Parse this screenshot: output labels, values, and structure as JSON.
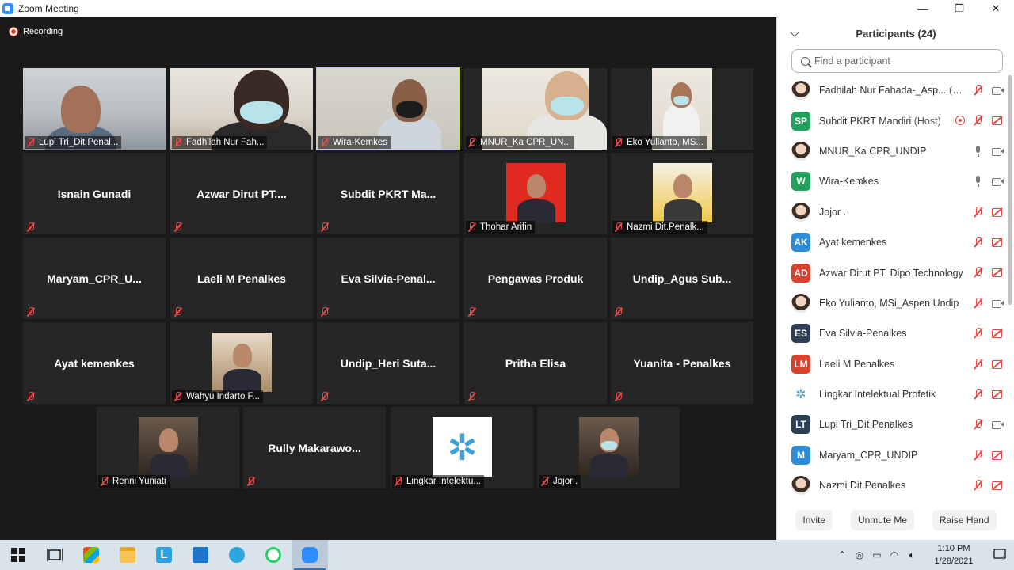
{
  "window": {
    "title": "Zoom Meeting",
    "minimize": "—",
    "restore": "❐",
    "close": "✕"
  },
  "meeting": {
    "recording_label": "Recording",
    "tiles": [
      {
        "name": "Lupi Tri_Dit Penal...",
        "kind": "video"
      },
      {
        "name": "Fadhilah Nur Fah...",
        "kind": "video"
      },
      {
        "name": "Wira-Kemkes",
        "kind": "video",
        "active": true
      },
      {
        "name": "MNUR_Ka CPR_UN...",
        "kind": "video"
      },
      {
        "name": "Eko Yulianto, MS...",
        "kind": "video"
      },
      {
        "name": "Isnain Gunadi",
        "kind": "name"
      },
      {
        "name": "Azwar Dirut PT....",
        "kind": "name"
      },
      {
        "name": "Subdit PKRT Ma...",
        "kind": "name"
      },
      {
        "name": "Thohar Arifin",
        "kind": "photo"
      },
      {
        "name": "Nazmi Dit.Penalk...",
        "kind": "photo"
      },
      {
        "name": "Maryam_CPR_U...",
        "kind": "name"
      },
      {
        "name": "Laeli M Penalkes",
        "kind": "name"
      },
      {
        "name": "Eva Silvia-Penal...",
        "kind": "name"
      },
      {
        "name": "Pengawas Produk",
        "kind": "name"
      },
      {
        "name": "Undip_Agus Sub...",
        "kind": "name"
      },
      {
        "name": "Ayat kemenkes",
        "kind": "name"
      },
      {
        "name": "Wahyu Indarto F...",
        "kind": "photo"
      },
      {
        "name": "Undip_Heri Suta...",
        "kind": "name"
      },
      {
        "name": "Pritha Elisa",
        "kind": "name"
      },
      {
        "name": "Yuanita - Penalkes",
        "kind": "name"
      },
      {
        "name": "Renni Yuniati",
        "kind": "photo"
      },
      {
        "name": "Rully Makarawo...",
        "kind": "name"
      },
      {
        "name": "Lingkar Intelektu...",
        "kind": "photo"
      },
      {
        "name": "Jojor .",
        "kind": "photo"
      }
    ]
  },
  "participants": {
    "title": "Participants (24)",
    "search_placeholder": "Find a participant",
    "list": [
      {
        "name": "Fadhilah Nur Fahada-_Asp...",
        "tag": "(Me)",
        "avatar": "",
        "avatar_color": "",
        "mic": "off",
        "cam": "on"
      },
      {
        "name": "Subdit PKRT Mandiri",
        "tag": "(Host)",
        "avatar": "SP",
        "avatar_color": "#1fa35c",
        "mic": "off",
        "cam": "off",
        "sharing": true
      },
      {
        "name": "MNUR_Ka CPR_UNDIP",
        "tag": "",
        "avatar": "",
        "avatar_color": "",
        "mic": "on",
        "cam": "on"
      },
      {
        "name": "Wira-Kemkes",
        "tag": "",
        "avatar": "W",
        "avatar_color": "#1fa35c",
        "mic": "on",
        "cam": "on"
      },
      {
        "name": "Jojor .",
        "tag": "",
        "avatar": "",
        "avatar_color": "",
        "mic": "off",
        "cam": "off"
      },
      {
        "name": "Ayat kemenkes",
        "tag": "",
        "avatar": "AK",
        "avatar_color": "#2d8cd8",
        "mic": "off",
        "cam": "off"
      },
      {
        "name": "Azwar Dirut PT. Dipo Technology",
        "tag": "",
        "avatar": "AD",
        "avatar_color": "#d9412d",
        "mic": "off",
        "cam": "off"
      },
      {
        "name": "Eko Yulianto, MSi_Aspen Undip",
        "tag": "",
        "avatar": "",
        "avatar_color": "",
        "mic": "off",
        "cam": "on"
      },
      {
        "name": "Eva Silvia-Penalkes",
        "tag": "",
        "avatar": "ES",
        "avatar_color": "#2e3e56",
        "mic": "off",
        "cam": "off"
      },
      {
        "name": "Laeli M Penalkes",
        "tag": "",
        "avatar": "LM",
        "avatar_color": "#d9412d",
        "mic": "off",
        "cam": "off"
      },
      {
        "name": "Lingkar Intelektual Profetik",
        "tag": "",
        "avatar": "✲",
        "avatar_color": "logo",
        "mic": "off",
        "cam": "off"
      },
      {
        "name": "Lupi Tri_Dit Penalkes",
        "tag": "",
        "avatar": "LT",
        "avatar_color": "#2e3e56",
        "mic": "off",
        "cam": "on"
      },
      {
        "name": "Maryam_CPR_UNDIP",
        "tag": "",
        "avatar": "M",
        "avatar_color": "#2d8cd8",
        "mic": "off",
        "cam": "off"
      },
      {
        "name": "Nazmi Dit.Penalkes",
        "tag": "",
        "avatar": "",
        "avatar_color": "",
        "mic": "off",
        "cam": "off"
      }
    ],
    "buttons": {
      "invite": "Invite",
      "unmute": "Unmute Me",
      "raise_hand": "Raise Hand"
    }
  },
  "taskbar": {
    "time": "1:10 PM",
    "date": "1/28/2021",
    "notification_count": "1"
  }
}
